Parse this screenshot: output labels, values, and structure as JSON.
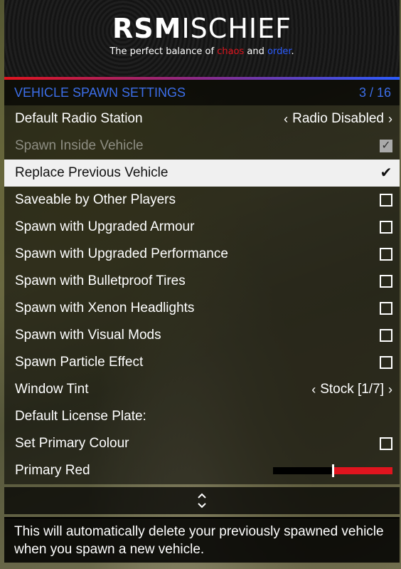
{
  "header": {
    "logo_bold": "RSM",
    "logo_thin": "ISCHIEF",
    "tagline_prefix": "The perfect balance of ",
    "tagline_chaos": "chaos",
    "tagline_mid": " and ",
    "tagline_order": "order",
    "tagline_suffix": "."
  },
  "subheader": {
    "title": "VEHICLE SPAWN SETTINGS",
    "counter": "3 / 16"
  },
  "items": [
    {
      "label": "Default Radio Station",
      "value": "Radio Disabled"
    },
    {
      "label": "Spawn Inside Vehicle",
      "checked": true
    },
    {
      "label": "Replace Previous Vehicle",
      "checked": true
    },
    {
      "label": "Saveable by Other Players",
      "checked": false
    },
    {
      "label": "Spawn with Upgraded Armour",
      "checked": false
    },
    {
      "label": "Spawn with Upgraded Performance",
      "checked": false
    },
    {
      "label": "Spawn with Bulletproof Tires",
      "checked": false
    },
    {
      "label": "Spawn with Xenon Headlights",
      "checked": false
    },
    {
      "label": "Spawn with Visual Mods",
      "checked": false
    },
    {
      "label": "Spawn Particle Effect",
      "checked": false
    },
    {
      "label": "Window Tint",
      "value": "Stock [1/7]"
    },
    {
      "label": "Default License Plate:"
    },
    {
      "label": "Set Primary Colour",
      "checked": false
    },
    {
      "label": "Primary Red",
      "slider_fraction": 0.5
    }
  ],
  "description": "This will automatically delete your previously spawned vehicle when you spawn a new vehicle.",
  "colors": {
    "accent_red": "#e0141e",
    "accent_blue": "#2b5cff",
    "subheader_blue": "#3c6ee8"
  }
}
